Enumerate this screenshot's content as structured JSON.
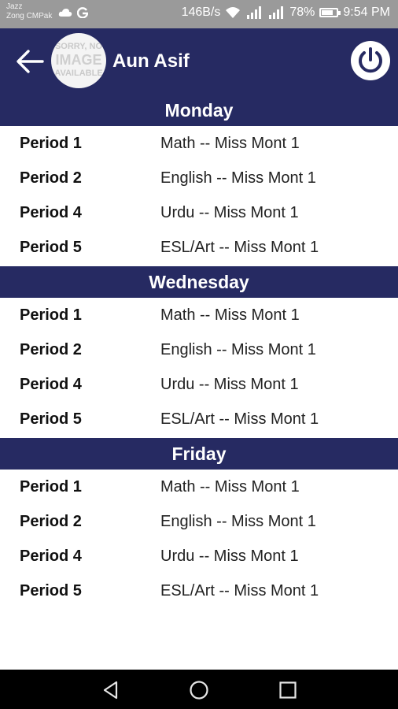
{
  "status_bar": {
    "carrier_1": "Jazz",
    "carrier_2": "Zong CMPak",
    "network_speed": "146B/s",
    "battery": "78%",
    "battery_level": 0.78,
    "time": "9:54 PM"
  },
  "app_bar": {
    "avatar_text_1": "SORRY, NO",
    "avatar_text_2": "IMAGE",
    "avatar_text_3": "AVAILABLE",
    "user_name": "Aun Asif"
  },
  "days": [
    {
      "name": "Monday",
      "periods": [
        {
          "period": "Period 1",
          "subject": "Math -- Miss Mont 1"
        },
        {
          "period": "Period 2",
          "subject": "English -- Miss Mont 1"
        },
        {
          "period": "Period 4",
          "subject": "Urdu -- Miss Mont 1"
        },
        {
          "period": "Period 5",
          "subject": "ESL/Art -- Miss Mont 1"
        }
      ]
    },
    {
      "name": "Wednesday",
      "periods": [
        {
          "period": "Period 1",
          "subject": "Math -- Miss Mont 1"
        },
        {
          "period": "Period 2",
          "subject": "English -- Miss Mont 1"
        },
        {
          "period": "Period 4",
          "subject": "Urdu -- Miss Mont 1"
        },
        {
          "period": "Period 5",
          "subject": "ESL/Art -- Miss Mont 1"
        }
      ]
    },
    {
      "name": "Friday",
      "periods": [
        {
          "period": "Period 1",
          "subject": "Math -- Miss Mont 1"
        },
        {
          "period": "Period 2",
          "subject": "English -- Miss Mont 1"
        },
        {
          "period": "Period 4",
          "subject": "Urdu -- Miss Mont 1"
        },
        {
          "period": "Period 5",
          "subject": "ESL/Art -- Miss Mont 1"
        }
      ]
    }
  ],
  "icons": {
    "back": "back-arrow-icon",
    "power": "power-icon",
    "nav_back": "nav-back-triangle-icon",
    "nav_home": "nav-home-circle-icon",
    "nav_recents": "nav-recents-square-icon"
  },
  "colors": {
    "primary": "#262a62",
    "status_bar": "#9a9a9a",
    "nav_bar": "#000000"
  }
}
